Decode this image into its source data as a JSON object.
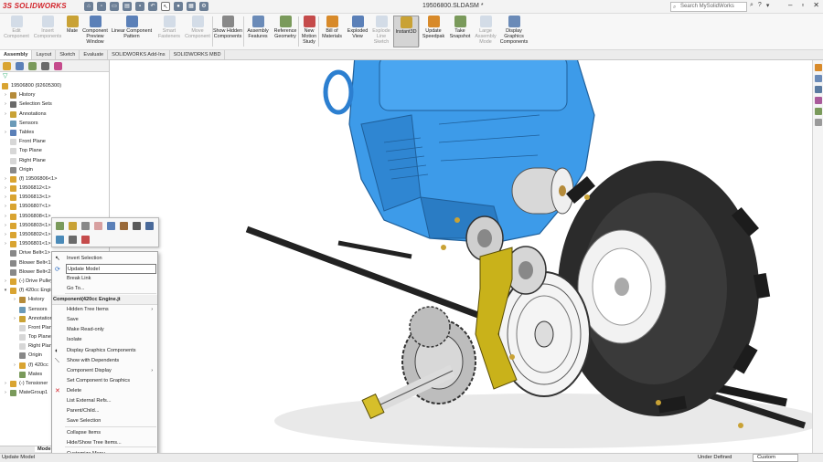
{
  "app": {
    "logo": "SOLIDWORKS",
    "logo_prefix": "3S",
    "document_title": "19506800.SLDASM *",
    "search_placeholder": "Search MySolidWorks"
  },
  "ribbon": {
    "buttons": [
      {
        "label": "Edit Component",
        "disabled": true
      },
      {
        "label": "Insert Components",
        "disabled": true
      },
      {
        "label": "Mate",
        "disabled": false
      },
      {
        "label": "Component Preview Window",
        "disabled": false
      },
      {
        "label": "Linear Component Pattern",
        "disabled": false
      },
      {
        "label": "Smart Fasteners",
        "disabled": true
      },
      {
        "label": "Move Component",
        "disabled": true
      },
      {
        "label": "Show Hidden Components",
        "disabled": false
      },
      {
        "label": "Assembly Features",
        "disabled": false
      },
      {
        "label": "Reference Geometry",
        "disabled": false
      },
      {
        "label": "New Motion Study",
        "disabled": false
      },
      {
        "label": "Bill of Materials",
        "disabled": false
      },
      {
        "label": "Exploded View",
        "disabled": false
      },
      {
        "label": "Explode Line Sketch",
        "disabled": true
      },
      {
        "label": "Instant3D",
        "disabled": false,
        "active": true
      },
      {
        "label": "Update Speedpak",
        "disabled": false
      },
      {
        "label": "Take Snapshot",
        "disabled": false
      },
      {
        "label": "Large Assembly Mode",
        "disabled": true
      },
      {
        "label": "Display Graphics Components",
        "disabled": false
      }
    ]
  },
  "tabs": [
    "Assembly",
    "Layout",
    "Sketch",
    "Evaluate",
    "SOLIDWORKS Add-Ins",
    "SOLIDWORKS MBD"
  ],
  "tree": {
    "root": "19506800 (92605300)",
    "items": [
      "History",
      "Selection Sets",
      "Annotations",
      "Sensors",
      "Tables",
      "Front Plane",
      "Top Plane",
      "Right Plane",
      "Origin",
      "(f) 19506806<1>",
      "19506812<1>",
      "19506813<1>",
      "19506807<1>",
      "19506808<1>",
      "19506803<1>",
      "19506802<1>",
      "19506801<1>",
      "Drive Belt<1>",
      "Blower Belt<1>",
      "Blower Belt<2>",
      "(-) Drive Pulley",
      "(f) 420cc Engine",
      "History",
      "Sensors",
      "Annotations",
      "Front Plane",
      "Top Plane",
      "Right Plane",
      "Origin",
      "(f) 420cc",
      "Mates",
      "(-) Tensioner",
      "MateGroup1"
    ],
    "bottom_tab": "Model"
  },
  "context_menu": {
    "items": [
      {
        "label": "Invert Selection"
      },
      {
        "label": "Update Model",
        "highlighted": true
      },
      {
        "label": "Break Link"
      },
      {
        "label": "Go To..."
      },
      {
        "label": "Component(420cc Engine.jt",
        "header": true
      },
      {
        "label": "Hidden Tree Items",
        "submenu": true
      },
      {
        "label": "Save"
      },
      {
        "label": "Make Read-only"
      },
      {
        "label": "Isolate"
      },
      {
        "label": "Display Graphics Components"
      },
      {
        "label": "Show with Dependents"
      },
      {
        "label": "Component Display",
        "submenu": true
      },
      {
        "label": "Set Component to Graphics"
      },
      {
        "label": "Delete"
      },
      {
        "label": "List External Refs..."
      },
      {
        "label": "Parent/Child..."
      },
      {
        "label": "Save Selection"
      },
      {
        "label": "Collapse Items"
      },
      {
        "label": "Hide/Show Tree Items..."
      },
      {
        "label": "Customize Menu"
      }
    ]
  },
  "status": {
    "left": "Update Model",
    "state": "Under Defined",
    "units": "Custom"
  },
  "colors": {
    "engine_blue": "#3d9be9",
    "tire_dark": "#2b2b2b",
    "bracket_yellow": "#c9b21a",
    "accent_red": "#d2232a"
  }
}
